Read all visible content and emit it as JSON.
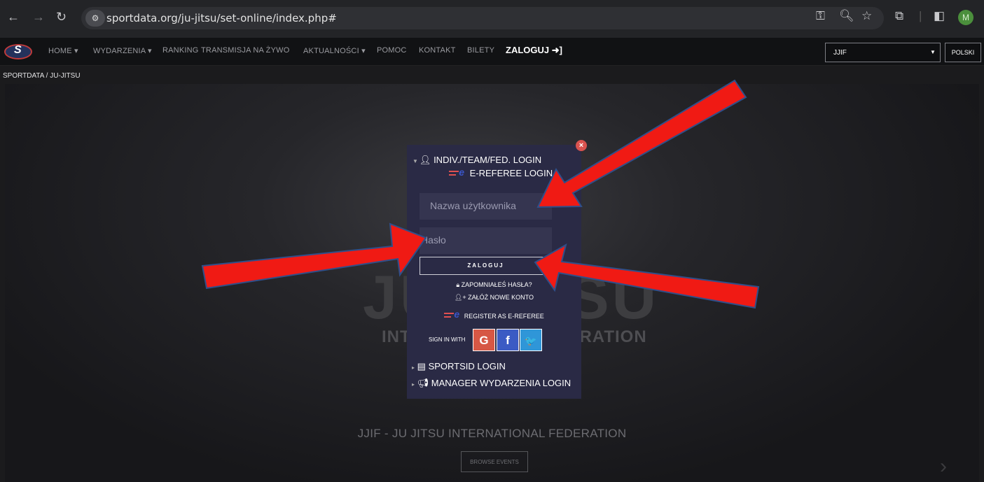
{
  "browser": {
    "url": "sportdata.org/ju-jitsu/set-online/index.php#",
    "avatar_letter": "M",
    "icons": [
      "back-icon",
      "forward-icon",
      "reload-icon",
      "site-settings-icon",
      "password-key-icon",
      "zoom-icon",
      "bookmark-star-icon",
      "extensions-icon",
      "side-panel-icon"
    ]
  },
  "nav": {
    "items": [
      "HOME ▾",
      "WYDARZENIA ▾",
      "RANKING",
      "TRANSMISJA NA ŻYWO",
      "AKTUALNOŚCI ▾",
      "POMOC",
      "KONTAKT",
      "BILETY"
    ],
    "login_label": "ZALOGUJ ➜]",
    "org_select_value": "JJIF",
    "language_label": "POLSKI"
  },
  "breadcrumb": "SPORTDATA / JU-JITSU",
  "hero": {
    "big_text": "JU-JITSU",
    "sub_text": "INTERNATIONAL FEDERATION",
    "title": "JJIF - JU JITSU INTERNATIONAL FEDERATION",
    "browse_label": "BROWSE EVENTS"
  },
  "modal": {
    "close_symbol": "×",
    "indiv_login": "INDIV./TEAM/FED. LOGIN",
    "ereferee_login": "E-REFEREE LOGIN",
    "username_placeholder": "Nazwa użytkownika",
    "password_placeholder": "Hasło",
    "login_button": "ZALOGUJ",
    "forgot_password": "ZAPOMNIAŁEŚ HASŁA?",
    "create_account": "ZAŁÓŻ NOWE KONTO",
    "register_ereferee": "REGISTER AS E-REFEREE",
    "sign_in_with": "SIGN IN WITH",
    "social": [
      "G",
      "f",
      "🐦"
    ],
    "sportsid_login": "SPORTSID LOGIN",
    "manager_login": "MANAGER WYDARZENIA LOGIN"
  },
  "colors": {
    "modal_bg": "#2a2a45",
    "arrow_fill": "#f01a14",
    "arrow_stroke": "#2f4f8a",
    "google": "#d65745",
    "facebook": "#3b5bc4",
    "twitter": "#2f96d8"
  }
}
